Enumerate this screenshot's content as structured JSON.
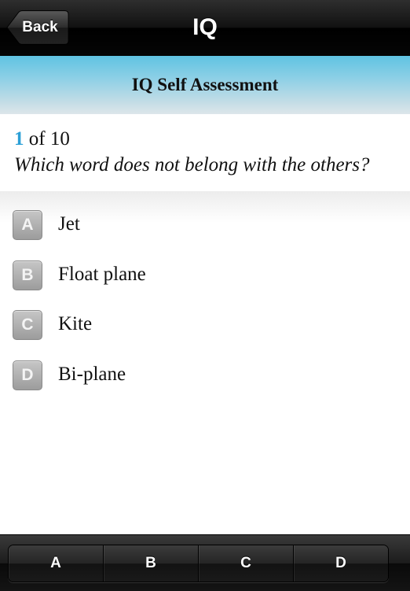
{
  "navbar": {
    "back_label": "Back",
    "title": "IQ"
  },
  "section": {
    "title": "IQ Self Assessment"
  },
  "question": {
    "current": "1",
    "of_text": " of 10",
    "text": "Which word does not belong with the others?"
  },
  "answers": [
    {
      "letter": "A",
      "label": "Jet"
    },
    {
      "letter": "B",
      "label": "Float plane"
    },
    {
      "letter": "C",
      "label": "Kite"
    },
    {
      "letter": "D",
      "label": "Bi-plane"
    }
  ],
  "toolbar": {
    "options": [
      "A",
      "B",
      "C",
      "D"
    ]
  },
  "colors": {
    "accent": "#2b9fd6",
    "header_gradient_top": "#5fc3e2"
  }
}
